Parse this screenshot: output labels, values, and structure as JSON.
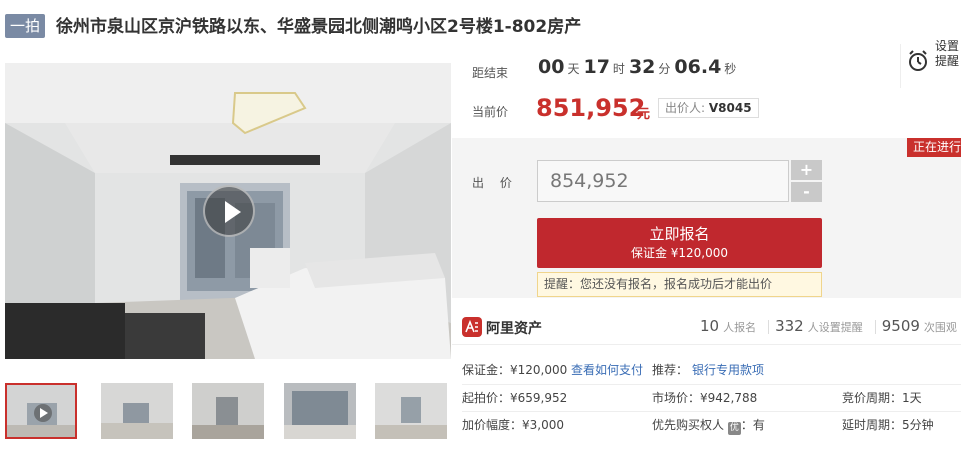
{
  "header": {
    "badge": "一拍",
    "title": "徐州市泉山区京沪铁路以东、华盛景园北侧潮鸣小区2号楼1-802房产"
  },
  "countdown": {
    "label": "距结束",
    "days": "00",
    "days_unit": "天",
    "hours": "17",
    "hours_unit": "时",
    "minutes": "32",
    "minutes_unit": "分",
    "seconds": "06.4",
    "seconds_unit": "秒"
  },
  "reminder": {
    "label": "设置提醒"
  },
  "price": {
    "label": "当前价",
    "value": "851,952",
    "unit": "元",
    "bidder_label": "出价人:",
    "bidder_id": "V8045"
  },
  "bid": {
    "status": "正在进行",
    "label": "出 价",
    "input_value": "854,952",
    "plus": "+",
    "minus": "-",
    "signup_label": "立即报名",
    "deposit_label": "保证金 ¥120,000",
    "tip": "提醒：您还没有报名，报名成功后才能出价"
  },
  "platform": {
    "name": "阿里资产"
  },
  "stats": {
    "signups": "10",
    "signups_unit": "人报名",
    "reminders": "332",
    "reminders_unit": "人设置提醒",
    "views": "9509",
    "views_unit": "次围观"
  },
  "details": {
    "deposit": "保证金：¥120,000",
    "how_to_pay": "查看如何支付",
    "recommend_label": "推荐：",
    "recommend_link": "银行专用款项",
    "start_price": "起拍价：¥659,952",
    "market_price": "市场价：¥942,788",
    "cycle": "竞价周期：1天",
    "increment": "加价幅度：¥3,000",
    "priority_label": "优先购买权人",
    "priority_icon": "优",
    "priority_value": "：有",
    "extension": "延时周期：5分钟"
  },
  "colors": {
    "accent": "#c0282e",
    "price": "#c9302c",
    "link": "#3a6db5"
  }
}
